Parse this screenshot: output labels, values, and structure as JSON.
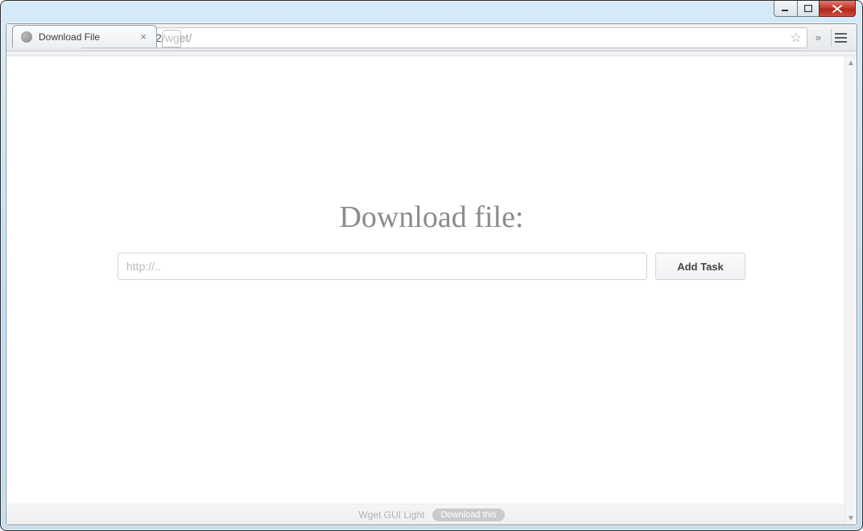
{
  "window": {
    "tab_title": "Download File"
  },
  "omnibox": {
    "host": "192.168.1.2",
    "path": "/wget/"
  },
  "page": {
    "heading": "Download file:",
    "url_placeholder": "http://..",
    "add_task_label": "Add Task"
  },
  "footer": {
    "app_name": "Wget GUI Light",
    "pill_label": "Download this"
  }
}
